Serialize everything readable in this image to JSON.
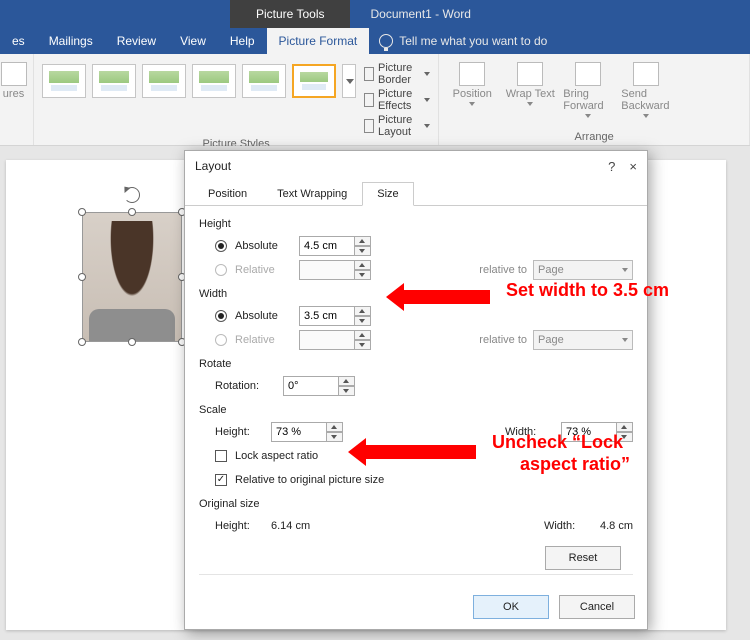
{
  "titlebar": {
    "context_tab": "Picture Tools",
    "doc_title": "Document1 - Word"
  },
  "tabs": {
    "t0": "es",
    "t1": "Mailings",
    "t2": "Review",
    "t3": "View",
    "t4": "Help",
    "t5": "Picture Format",
    "tellme": "Tell me what you want to do"
  },
  "ribbon": {
    "ures": "ures",
    "picture_styles": "Picture Styles",
    "border": "Picture Border",
    "effects": "Picture Effects",
    "layout": "Picture Layout",
    "position": "Position",
    "wrap": "Wrap Text",
    "bring": "Bring Forward",
    "send": "Send Backward",
    "arrange": "Arrange"
  },
  "dialog": {
    "title": "Layout",
    "help": "?",
    "close": "×",
    "tabs": {
      "position": "Position",
      "wrap": "Text Wrapping",
      "size": "Size"
    },
    "height": {
      "label": "Height",
      "absolute": "Absolute",
      "abs_val": "4.5 cm",
      "relative": "Relative",
      "relative_to": "relative to",
      "rel_target": "Page"
    },
    "width": {
      "label": "Width",
      "absolute": "Absolute",
      "abs_val": "3.5 cm",
      "relative": "Relative",
      "relative_to": "relative to",
      "rel_target": "Page"
    },
    "rotate": {
      "label": "Rotate",
      "rotation": "Rotation:",
      "val": "0°"
    },
    "scale": {
      "label": "Scale",
      "height": "Height:",
      "h_val": "73 %",
      "width": "Width:",
      "w_val": "73 %",
      "lock": "Lock aspect ratio",
      "rel_orig": "Relative to original picture size"
    },
    "original": {
      "label": "Original size",
      "height": "Height:",
      "h_val": "6.14 cm",
      "width": "Width:",
      "w_val": "4.8 cm"
    },
    "reset": "Reset",
    "ok": "OK",
    "cancel": "Cancel"
  },
  "annot": {
    "a1": "Set width to 3.5 cm",
    "a2a": "Uncheck “Lock",
    "a2b": "aspect ratio”"
  }
}
